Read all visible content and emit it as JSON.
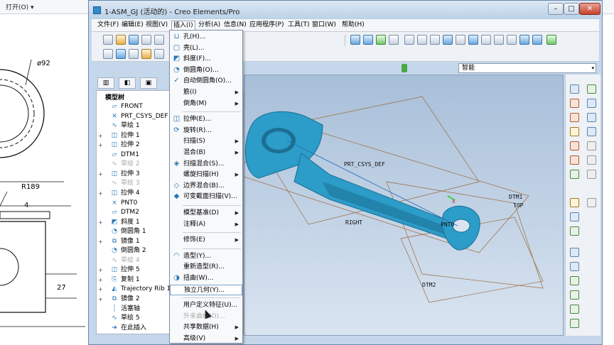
{
  "viewer": {
    "open_menu": "打开(O) ▾",
    "drawing_labels": {
      "dia": "ø92",
      "r189": "R189",
      "dim4": "4",
      "dim27": "27"
    }
  },
  "window": {
    "title": "1-ASM_GJ (活动的) - Creo Elements/Pro",
    "minimize": "–",
    "maximize": "□",
    "close": "✕"
  },
  "menubar": {
    "items": [
      "文件(F)",
      "编辑(E)",
      "视图(V)",
      "插入(I)",
      "分析(A)",
      "信息(N)",
      "应用程序(P)",
      "工具(T)",
      "窗口(W)",
      "帮助(H)"
    ]
  },
  "filter": {
    "value": "智能",
    "arrow": "▾"
  },
  "tree": {
    "header": "模型树",
    "tabs": [
      "▥",
      "◧",
      "▣"
    ],
    "items": [
      {
        "label": "FRONT",
        "icon": "▱",
        "expand": ""
      },
      {
        "label": "PRT_CSYS_DEF",
        "icon": "✕",
        "expand": ""
      },
      {
        "label": "草绘 1",
        "icon": "∿",
        "expand": ""
      },
      {
        "label": "拉伸 1",
        "icon": "◫",
        "expand": "+"
      },
      {
        "label": "拉伸 2",
        "icon": "◫",
        "expand": "+"
      },
      {
        "label": "DTM1",
        "icon": "▱",
        "expand": ""
      },
      {
        "label": "草绘 2",
        "icon": "∿",
        "expand": "",
        "gray": true
      },
      {
        "label": "拉伸 3",
        "icon": "◫",
        "expand": "+"
      },
      {
        "label": "草绘 3",
        "icon": "∿",
        "expand": "",
        "gray": true
      },
      {
        "label": "拉伸 4",
        "icon": "◫",
        "expand": "+"
      },
      {
        "label": "PNT0",
        "icon": "×",
        "expand": ""
      },
      {
        "label": "DTM2",
        "icon": "▱",
        "expand": ""
      },
      {
        "label": "斜度 1",
        "icon": "◩",
        "expand": "+"
      },
      {
        "label": "倒圆角 1",
        "icon": "◔",
        "expand": ""
      },
      {
        "label": "镜像 1",
        "icon": "⧉",
        "expand": "+"
      },
      {
        "label": "倒圆角 2",
        "icon": "◔",
        "expand": ""
      },
      {
        "label": "草绘 4",
        "icon": "∿",
        "expand": "",
        "gray": true
      },
      {
        "label": "拉伸 5",
        "icon": "◫",
        "expand": "+"
      },
      {
        "label": "复制 1",
        "icon": "⎘",
        "expand": "+"
      },
      {
        "label": "Trajectory Rib 1",
        "icon": "◭",
        "expand": "+"
      },
      {
        "label": "镜像 2",
        "icon": "⧉",
        "expand": "+"
      },
      {
        "label": "活塞轴",
        "icon": "┆",
        "expand": ""
      },
      {
        "label": "草绘 5",
        "icon": "∿",
        "expand": ""
      },
      {
        "label": "在此插入",
        "icon": "➜",
        "expand": ""
      }
    ]
  },
  "insert_menu": {
    "items": [
      {
        "label": "孔(H)...",
        "icon": "⊔"
      },
      {
        "label": "壳(L)...",
        "icon": "▢"
      },
      {
        "label": "斜度(F)...",
        "icon": "◩"
      },
      {
        "label": "倒圆角(O)...",
        "icon": "◔"
      },
      {
        "label": "自动倒圆角(O)...",
        "icon": "✓"
      },
      {
        "label": "筋(I)",
        "icon": "",
        "sub": true
      },
      {
        "label": "倒角(M)",
        "icon": "",
        "sub": true
      },
      {
        "sep": true
      },
      {
        "label": "拉伸(E)...",
        "icon": "◫"
      },
      {
        "label": "旋转(R)...",
        "icon": "⟳"
      },
      {
        "label": "扫描(S)",
        "icon": "",
        "sub": true
      },
      {
        "label": "混合(B)",
        "icon": "",
        "sub": true
      },
      {
        "label": "扫描混合(S)...",
        "icon": "◈"
      },
      {
        "label": "螺旋扫描(H)",
        "icon": "",
        "sub": true
      },
      {
        "label": "边界混合(B)...",
        "icon": "◇"
      },
      {
        "label": "可变截面扫描(V)...",
        "icon": "◆"
      },
      {
        "sep": true
      },
      {
        "label": "模型基准(D)",
        "icon": "",
        "sub": true
      },
      {
        "label": "注释(A)",
        "icon": "",
        "sub": true
      },
      {
        "sep": true
      },
      {
        "label": "修饰(E)",
        "icon": "",
        "sub": true
      },
      {
        "sep": true
      },
      {
        "label": "造型(Y)...",
        "icon": "◠"
      },
      {
        "label": "重新造型(R)...",
        "icon": ""
      },
      {
        "label": "扭曲(W)...",
        "icon": "◑"
      },
      {
        "label": "独立几何(Y)...",
        "icon": "",
        "hl": true
      },
      {
        "sep": true
      },
      {
        "label": "用户定义特征(U)...",
        "icon": ""
      },
      {
        "label": "外来曲线(O)...",
        "icon": "",
        "dis": true
      },
      {
        "label": "共享数据(H)",
        "icon": "",
        "sub": true
      },
      {
        "label": "高级(V)",
        "icon": "",
        "sub": true
      }
    ]
  },
  "viewport_labels": {
    "csys": "PRT_CSYS_DEF",
    "right": "RIGHT",
    "dtm1": "DTM1",
    "top": "TOP",
    "dtm2": "DTM2",
    "pnt0": "PNT0",
    "marker": "x"
  },
  "colors": {
    "part": "#2c9cc8",
    "part_dark": "#1c6f93",
    "datum": "#9b6a3c",
    "background_top": "#a8bfd9",
    "background_bottom": "#d9e4f0"
  }
}
